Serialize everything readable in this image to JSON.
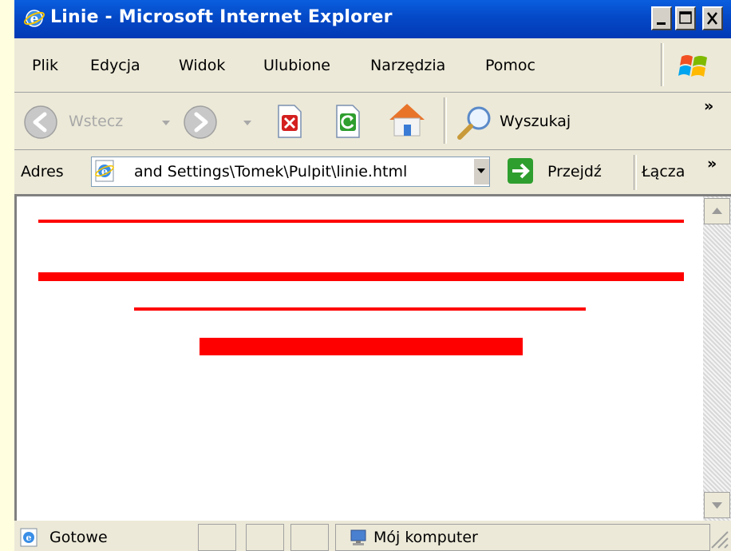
{
  "window": {
    "title": "Linie - Microsoft Internet Explorer"
  },
  "menubar": {
    "items": [
      "Plik",
      "Edycja",
      "Widok",
      "Ulubione",
      "Narzędzia",
      "Pomoc"
    ]
  },
  "toolbar": {
    "back_label": "Wstecz",
    "search_label": "Wyszukaj",
    "overflow": "»"
  },
  "address": {
    "label": "Adres",
    "value": "and Settings\\Tomek\\Pulpit\\linie.html",
    "go_label": "Przejdź",
    "links_label": "Łącza",
    "overflow": "»"
  },
  "page": {
    "line_color": "#FF0000"
  },
  "status": {
    "text": "Gotowe",
    "zone": "Mój komputer"
  }
}
